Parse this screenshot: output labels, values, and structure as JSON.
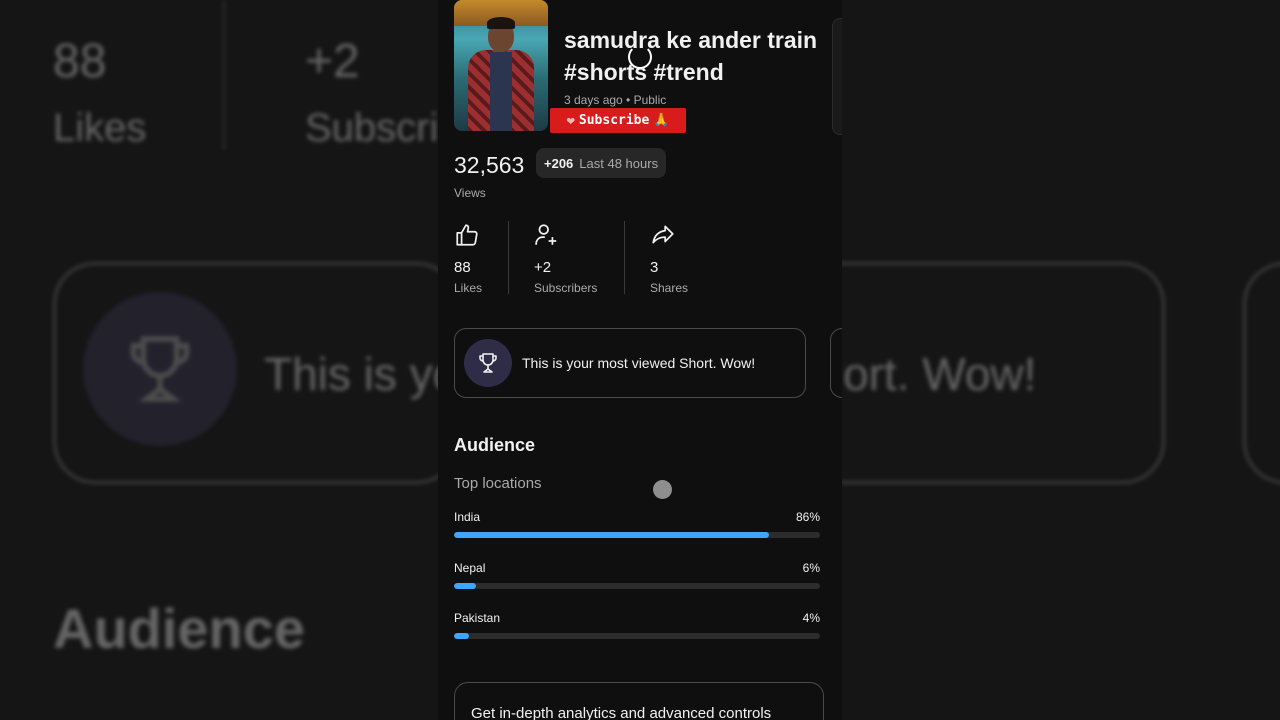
{
  "video": {
    "title": "samudra ke ander train #shorts #trend",
    "meta": "3 days ago • Public",
    "sticker": "Subscribe"
  },
  "views": {
    "count": "32,563",
    "delta": "+206",
    "period": "Last 48 hours",
    "label": "Views"
  },
  "stats": [
    {
      "value": "88",
      "label": "Likes",
      "icon": "thumbs-up-icon"
    },
    {
      "value": "+2",
      "label": "Subscribers",
      "icon": "person-add-icon"
    },
    {
      "value": "3",
      "label": "Shares",
      "icon": "share-icon"
    }
  ],
  "milestone": {
    "text": "This is your most viewed Short. Wow!",
    "icon": "trophy-icon"
  },
  "audience": {
    "title": "Audience",
    "locations_title": "Top locations",
    "locations": [
      {
        "name": "India",
        "percent": "86%",
        "value": 0.86
      },
      {
        "name": "Nepal",
        "percent": "6%",
        "value": 0.06
      },
      {
        "name": "Pakistan",
        "percent": "4%",
        "value": 0.04
      }
    ]
  },
  "promo": {
    "text": "Get in-depth analytics and advanced controls"
  },
  "background": {
    "likes_value": "88",
    "likes_label": "Likes",
    "subs_value": "+2",
    "subs_label": "Subscri",
    "card_text_left": "This is yo",
    "card_text_right": "ort. Wow!",
    "audience": "Audience"
  },
  "colors": {
    "accent": "#3ea6ff",
    "subscribe_red": "#d81b1b",
    "background": "#0f0f0f"
  }
}
